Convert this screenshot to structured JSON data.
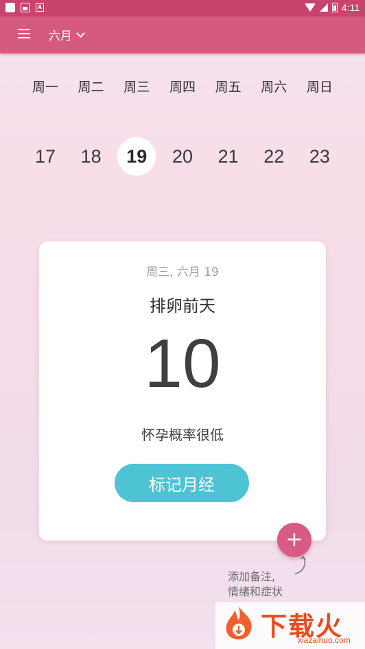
{
  "status_bar": {
    "time": "4:11"
  },
  "app_bar": {
    "month_label": "六月"
  },
  "week": {
    "days": [
      "周一",
      "周二",
      "周三",
      "周四",
      "周五",
      "周六",
      "周日"
    ],
    "dates": [
      "17",
      "18",
      "19",
      "20",
      "21",
      "22",
      "23"
    ],
    "selected_index": 2
  },
  "card": {
    "date_label": "周三, 六月 19",
    "phase_label": "排卵前天",
    "countdown": "10",
    "chance_label": "怀孕概率很低",
    "log_button_label": "标记月经"
  },
  "fab": {
    "label": "+",
    "hint_line1": "添加备注,",
    "hint_line2": "情绪和症状"
  },
  "watermark": {
    "text": "下载火",
    "url": "xiazaihuo.com"
  },
  "colors": {
    "app_bar": "#d55a80",
    "status_bar": "#c9446c",
    "button": "#4ec3d3",
    "fab": "#d95a84"
  }
}
